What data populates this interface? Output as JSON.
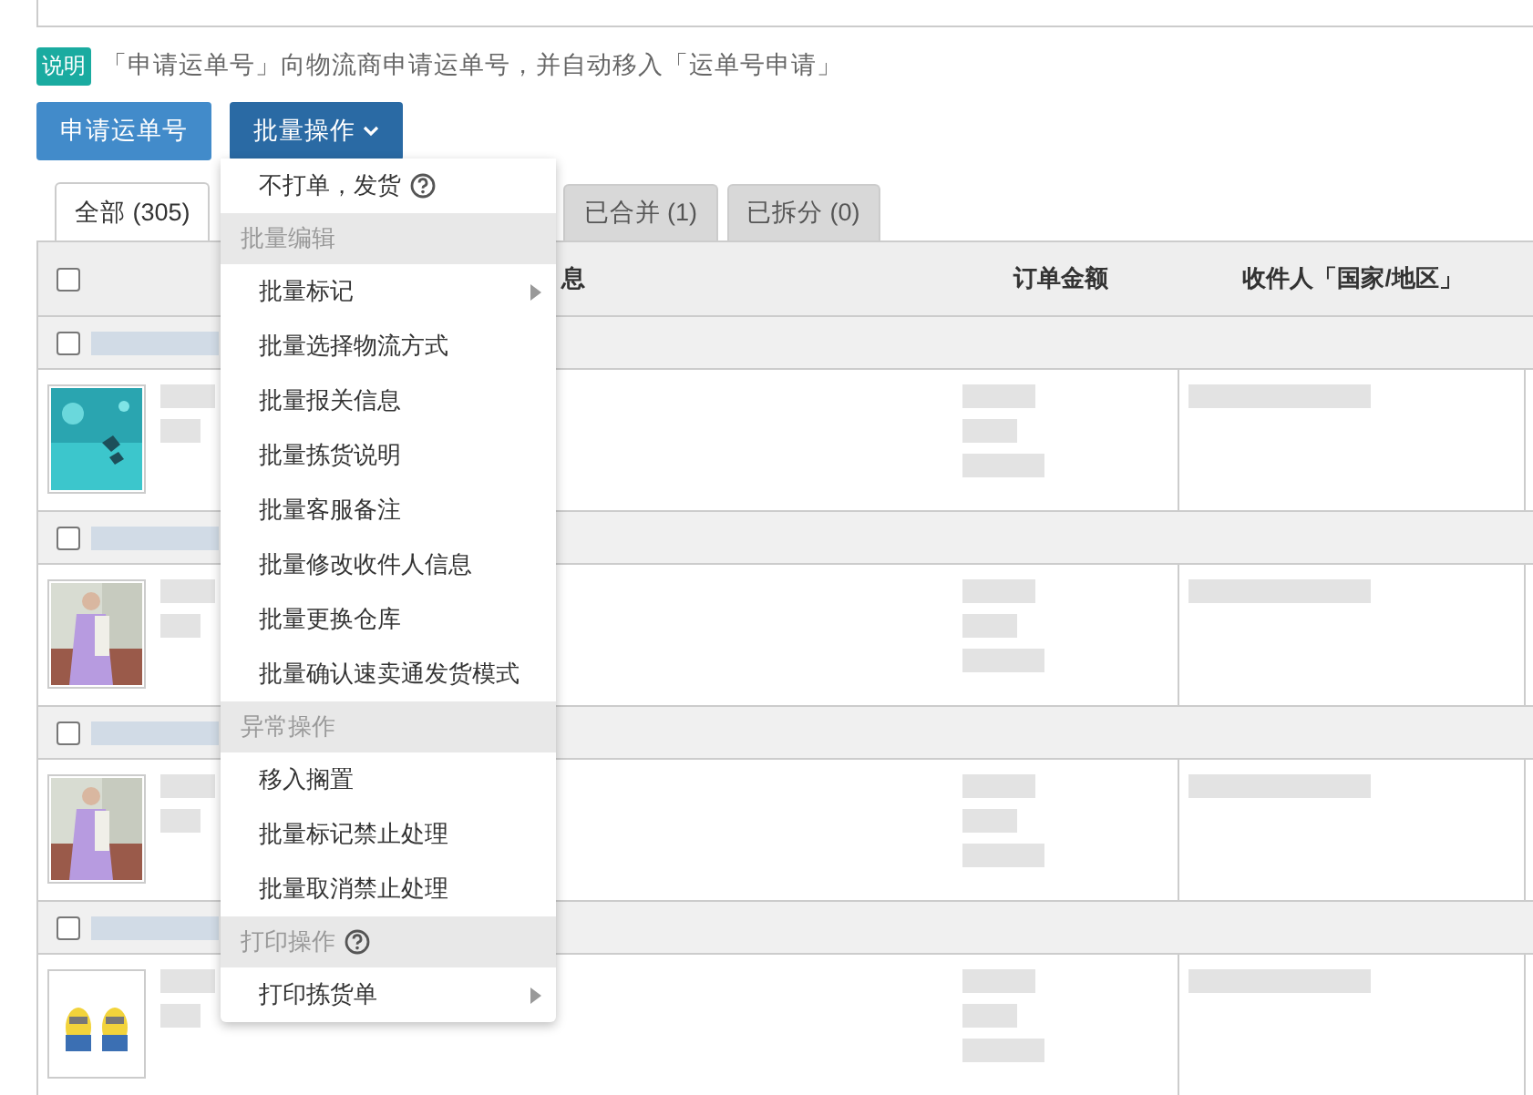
{
  "notice": {
    "badge": "说明",
    "text": "「申请运单号」向物流商申请运单号，并自动移入「运单号申请」"
  },
  "buttons": [
    {
      "label": "申请运单号",
      "kind": "plain"
    },
    {
      "label": "批量操作",
      "kind": "dropdown",
      "expanded": true
    }
  ],
  "tabs": [
    {
      "label": "全部 (305)",
      "selected": true
    },
    {
      "label": "已合并 (1)",
      "selected": false
    },
    {
      "label": "已拆分 (0)",
      "selected": false
    }
  ],
  "table": {
    "columns": [
      "息",
      "订单金额",
      "收件人「国家/地区」"
    ],
    "header_checked": false,
    "orders": [
      {
        "checked": false,
        "kind": "picture"
      },
      {
        "checked": false,
        "kind": "picture"
      },
      {
        "checked": false,
        "kind": "picture"
      },
      {
        "checked": false,
        "kind": "picture"
      }
    ]
  },
  "menu": {
    "items": [
      {
        "kind": "item",
        "label": "不打单，发货",
        "help": true
      },
      {
        "kind": "header",
        "label": "批量编辑"
      },
      {
        "kind": "item",
        "label": "批量标记",
        "submenu": true
      },
      {
        "kind": "item",
        "label": "批量选择物流方式"
      },
      {
        "kind": "item",
        "label": "批量报关信息"
      },
      {
        "kind": "item",
        "label": "批量拣货说明"
      },
      {
        "kind": "item",
        "label": "批量客服备注"
      },
      {
        "kind": "item",
        "label": "批量修改收件人信息"
      },
      {
        "kind": "item",
        "label": "批量更换仓库"
      },
      {
        "kind": "item",
        "label": "批量确认速卖通发货模式"
      },
      {
        "kind": "header",
        "label": "异常操作"
      },
      {
        "kind": "item",
        "label": "移入搁置"
      },
      {
        "kind": "item",
        "label": "批量标记禁止处理"
      },
      {
        "kind": "item",
        "label": "批量取消禁止处理"
      },
      {
        "kind": "header",
        "label": "打印操作",
        "help": true
      },
      {
        "kind": "item",
        "label": "打印拣货单",
        "submenu": true
      }
    ]
  }
}
